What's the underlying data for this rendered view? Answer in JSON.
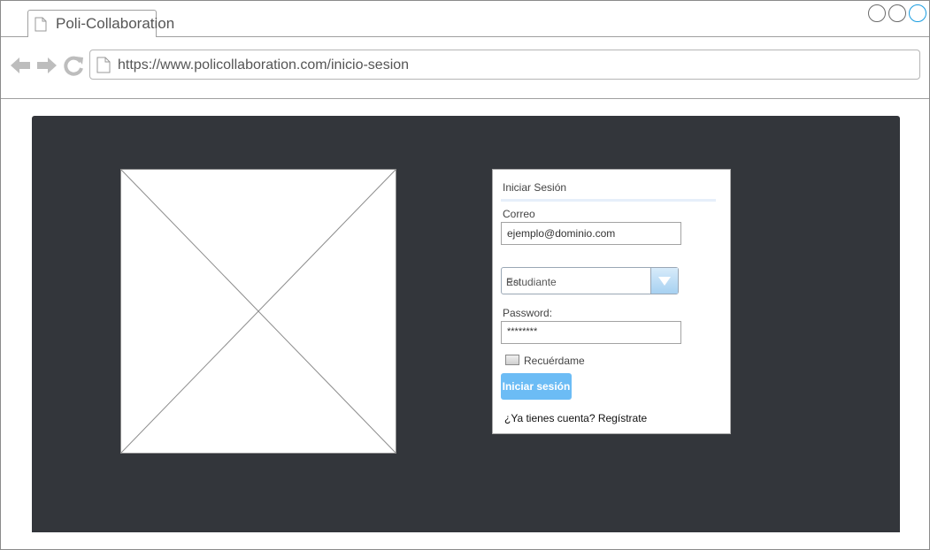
{
  "browser": {
    "tab_title": "Poli-Collaboration",
    "url": "https://www.policollaboration.com/inicio-sesion"
  },
  "login": {
    "title": "Iniciar Sesión",
    "email_label": "Correo",
    "email_value": "ejemplo@dominio.com",
    "role_label": "Rol",
    "role_selected": "Estudiante",
    "password_label": "Password:",
    "password_value": "********",
    "remember_label": "Recuérdame",
    "submit_label": "Iniciar sesión",
    "register_text": "¿Ya tienes cuenta? Regístrate"
  },
  "colors": {
    "canvas_bg": "#33363b",
    "button_bg": "#6cbcf5",
    "accent_circle": "#1a9de0"
  }
}
